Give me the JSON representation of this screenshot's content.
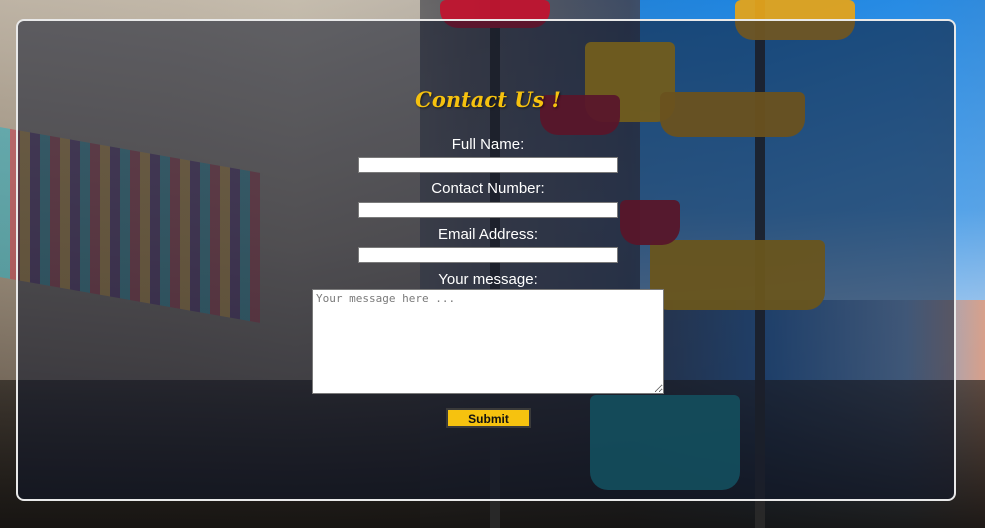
{
  "form": {
    "title": "Contact Us !",
    "fields": [
      {
        "label": "Full Name:",
        "value": "",
        "placeholder": ""
      },
      {
        "label": "Contact Number:",
        "value": "",
        "placeholder": ""
      },
      {
        "label": "Email Address:",
        "value": "",
        "placeholder": ""
      }
    ],
    "message": {
      "label": "Your message:",
      "placeholder": "Your message here ..."
    },
    "submit_label": "Submit"
  },
  "colors": {
    "accent": "#f6c20f",
    "panel_border": "#e9e9e9",
    "text": "#ffffff"
  }
}
